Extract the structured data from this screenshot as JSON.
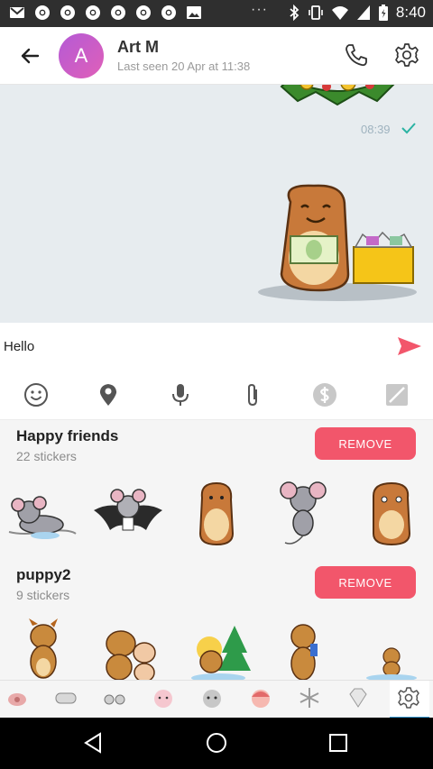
{
  "statusbar": {
    "time": "8:40",
    "more": "···"
  },
  "header": {
    "avatar_letter": "A",
    "name": "Art M",
    "last_seen": "Last seen 20 Apr at 11:38"
  },
  "chat": {
    "message_time": "08:39"
  },
  "composer": {
    "value": "Hello"
  },
  "packs": [
    {
      "title": "Happy friends",
      "count": "22 stickers",
      "remove_label": "REMOVE"
    },
    {
      "title": "puppy2",
      "count": "9 stickers",
      "remove_label": "REMOVE"
    }
  ],
  "colors": {
    "accent": "#f2566b",
    "avatar_start": "#b45ad6",
    "avatar_end": "#e060b8",
    "tab_indicator": "#3a9bd5"
  }
}
